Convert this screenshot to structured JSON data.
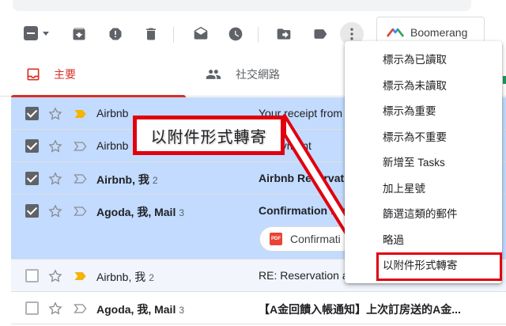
{
  "toolbar": {
    "icons": [
      "select-all-checkbox",
      "archive-icon",
      "report-spam-icon",
      "delete-icon",
      "mark-read-icon",
      "snooze-icon",
      "move-to-icon",
      "label-icon",
      "more-vert-icon"
    ],
    "boomerang_label": "Boomerang"
  },
  "tabs": {
    "primary": "主要",
    "social": "社交網路"
  },
  "emails": [
    {
      "sender": "Airbnb",
      "count": "",
      "subject": "Your receipt from",
      "selected": true,
      "important": true,
      "unread": false
    },
    {
      "sender": "Airbnb",
      "count": "",
      "subject": "o Payment",
      "selected": true,
      "important": false,
      "unread": false
    },
    {
      "sender": "Airbnb, 我",
      "count": "2",
      "subject": "Airbnb Reservatio",
      "selected": true,
      "important": false,
      "unread": true
    },
    {
      "sender": "Agoda, 我, Mail",
      "count": "3",
      "subject": "Confirmation for",
      "selected": true,
      "important": false,
      "unread": true,
      "attachment": "Confirmati"
    },
    {
      "sender": "Airbnb, 我",
      "count": "2",
      "subject": "RE: Reservation a",
      "selected": false,
      "important": true,
      "unread": false
    },
    {
      "sender": "Agoda, 我, Mail",
      "count": "3",
      "subject": "【A金回饋入帳通知】上次訂房送的A金...",
      "selected": false,
      "important": false,
      "unread": true
    }
  ],
  "menu": {
    "items": [
      "標示為已讀取",
      "標示為未讀取",
      "標示為重要",
      "標示為不重要",
      "新增至 Tasks",
      "加上星號",
      "篩選這類的郵件",
      "略過",
      "以附件形式轉寄"
    ],
    "highlighted_index": 8
  },
  "callout": {
    "text": "以附件形式轉寄"
  },
  "colors": {
    "accent_red": "#d93025",
    "annotation_red": "#e0000f",
    "selected_row": "#c2dbff",
    "important_marker": "#f4b400"
  }
}
